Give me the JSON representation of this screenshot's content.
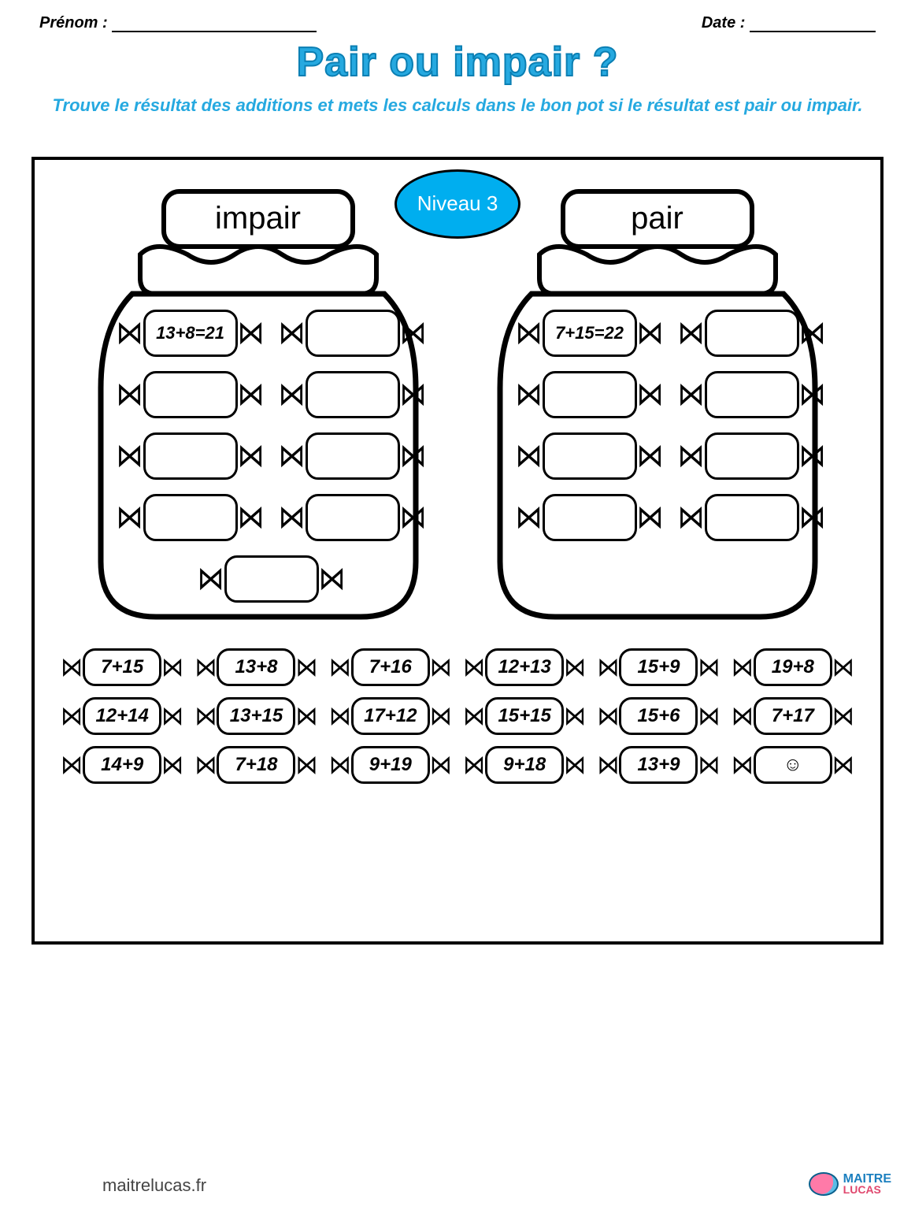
{
  "meta": {
    "name_label": "Prénom :",
    "date_label": "Date :"
  },
  "title": "Pair ou impair ?",
  "subtitle": "Trouve le résultat des additions et mets les calculs dans le bon pot si le résultat est pair ou impair.",
  "level_label": "Niveau 3",
  "jars": {
    "left": {
      "label": "impair",
      "slots": [
        "13+8=21",
        "",
        "",
        "",
        "",
        "",
        "",
        "",
        ""
      ],
      "layout": "4rows2cols_plus_center"
    },
    "right": {
      "label": "pair",
      "slots": [
        "7+15=22",
        "",
        "",
        "",
        "",
        "",
        "",
        ""
      ],
      "layout": "4rows2cols"
    }
  },
  "pool": [
    "7+15",
    "13+8",
    "7+16",
    "12+13",
    "15+9",
    "19+8",
    "12+14",
    "13+15",
    "17+12",
    "15+15",
    "15+6",
    "7+17",
    "14+9",
    "7+18",
    "9+19",
    "9+18",
    "13+9",
    "☺"
  ],
  "footer": {
    "url": "maitrelucas.fr",
    "logo_line1": "MAITRE",
    "logo_line2": "LUCAS"
  }
}
